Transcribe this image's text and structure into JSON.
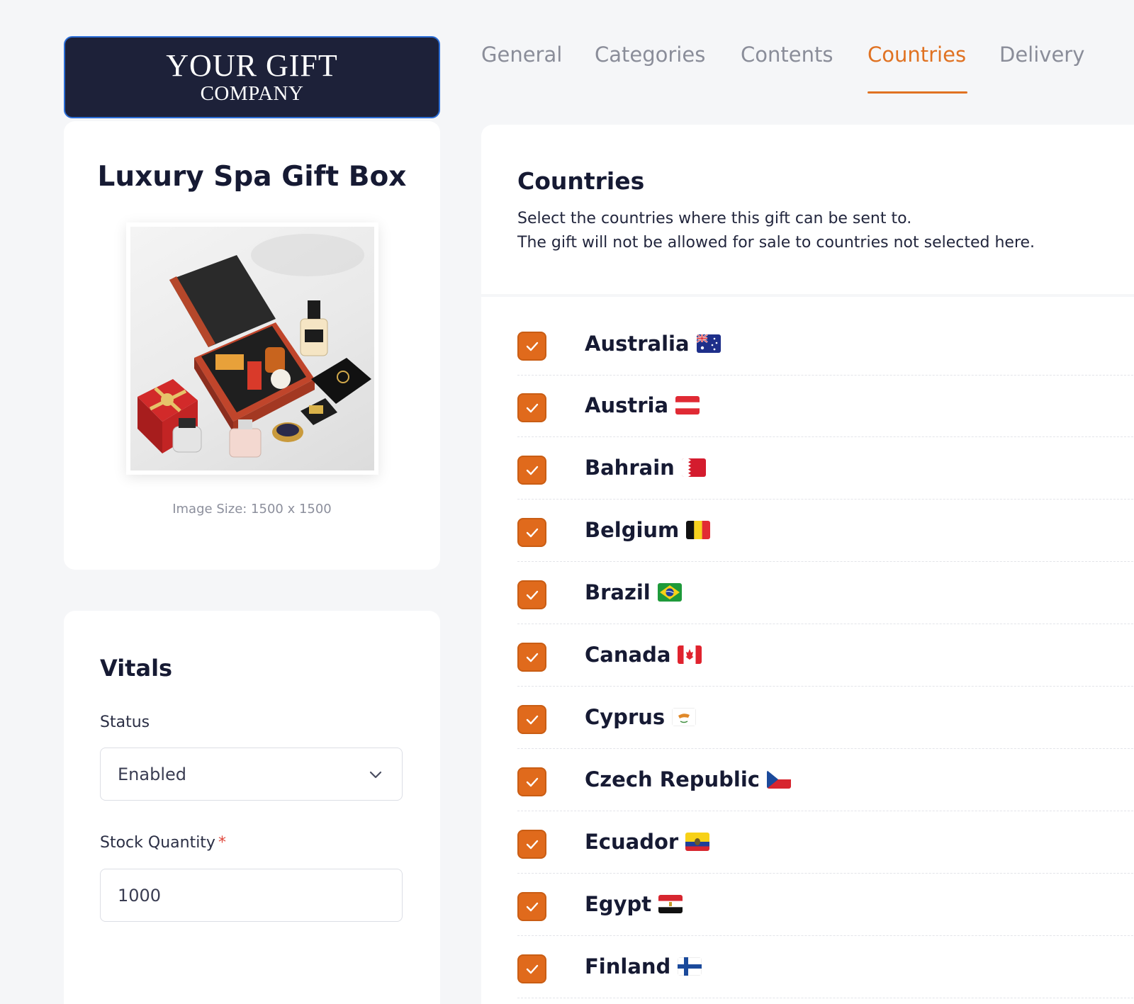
{
  "logo": {
    "line1": "YOUR GIFT",
    "line2": "COMPANY"
  },
  "product": {
    "title": "Luxury Spa Gift Box",
    "image_size": "Image Size: 1500 x 1500"
  },
  "vitals": {
    "title": "Vitals",
    "status_label": "Status",
    "status_value": "Enabled",
    "stock_label": "Stock Quantity",
    "stock_required_mark": "*",
    "stock_value": "1000"
  },
  "tabs": [
    {
      "label": "General",
      "active": false
    },
    {
      "label": "Categories",
      "active": false
    },
    {
      "label": "Contents",
      "active": false
    },
    {
      "label": "Countries",
      "active": true
    },
    {
      "label": "Delivery",
      "active": false
    }
  ],
  "countries_section": {
    "title": "Countries",
    "desc_line1": "Select the countries where this gift can be sent to.",
    "desc_line2": "The gift will not be allowed for sale to countries not selected here."
  },
  "countries": [
    {
      "name": "Australia",
      "checked": true,
      "flag": "australia-flag-icon"
    },
    {
      "name": "Austria",
      "checked": true,
      "flag": "austria-flag-icon"
    },
    {
      "name": "Bahrain",
      "checked": true,
      "flag": "bahrain-flag-icon"
    },
    {
      "name": "Belgium",
      "checked": true,
      "flag": "belgium-flag-icon"
    },
    {
      "name": "Brazil",
      "checked": true,
      "flag": "brazil-flag-icon"
    },
    {
      "name": "Canada",
      "checked": true,
      "flag": "canada-flag-icon"
    },
    {
      "name": "Cyprus",
      "checked": true,
      "flag": "cyprus-flag-icon"
    },
    {
      "name": "Czech Republic",
      "checked": true,
      "flag": "czech-flag-icon"
    },
    {
      "name": "Ecuador",
      "checked": true,
      "flag": "ecuador-flag-icon"
    },
    {
      "name": "Egypt",
      "checked": true,
      "flag": "egypt-flag-icon"
    },
    {
      "name": "Finland",
      "checked": true,
      "flag": "finland-flag-icon"
    }
  ],
  "colors": {
    "accent": "#e07222",
    "checkbox": "#e06a1c",
    "logo_bg": "#1d2139",
    "text_dark": "#161a33",
    "tab_inactive": "#8a8d99"
  }
}
